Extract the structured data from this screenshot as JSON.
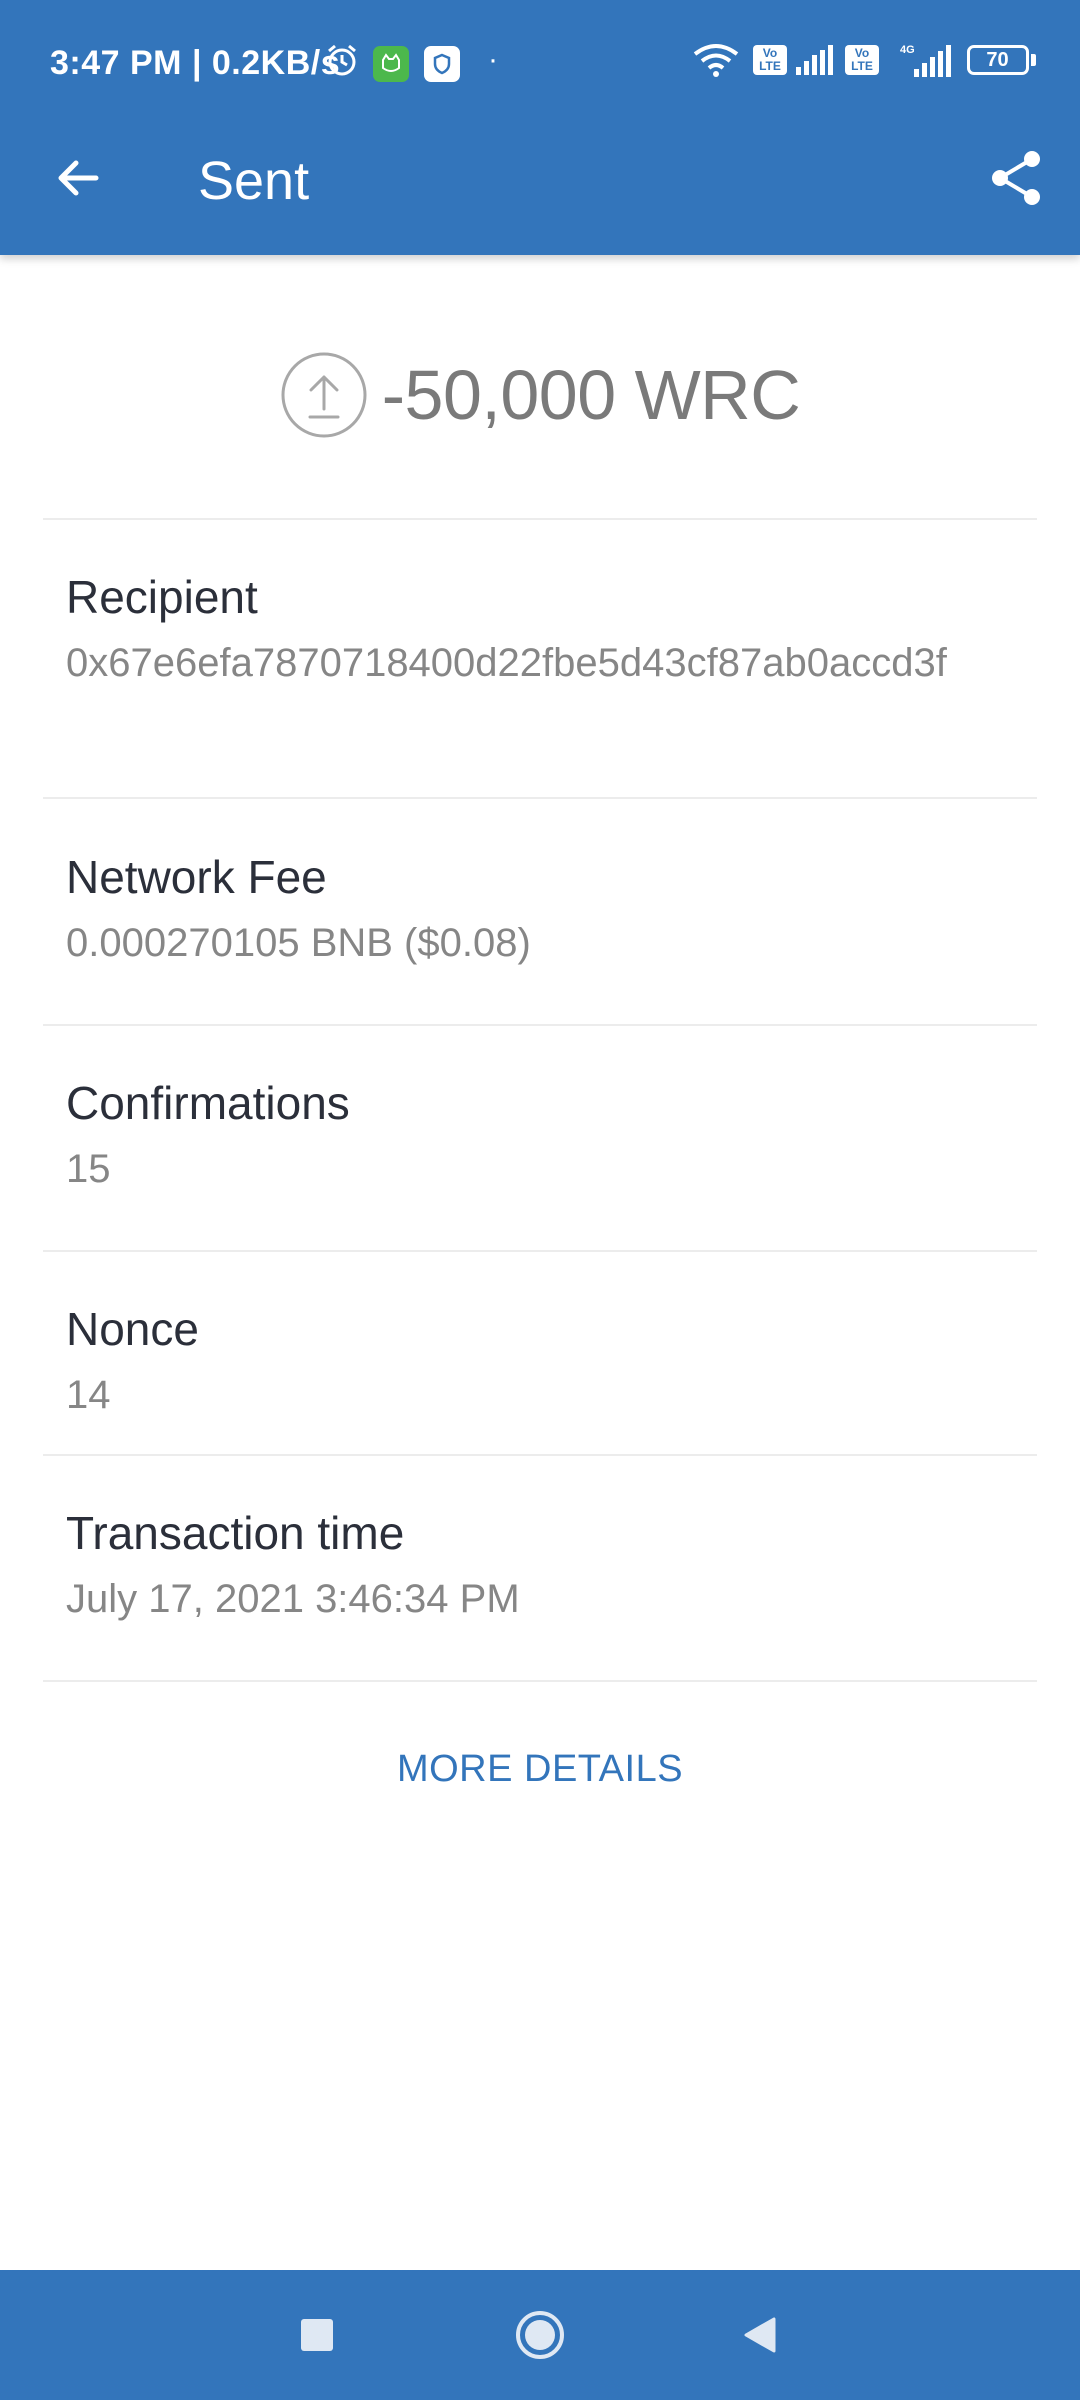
{
  "status_bar": {
    "time": "3:47 PM | 0.2KB/s",
    "volte_label": "Vo LTE",
    "network_label": "4G",
    "battery_level": "70"
  },
  "app_bar": {
    "title": "Sent"
  },
  "transaction": {
    "amount": "-50,000 WRC",
    "fields": [
      {
        "label": "Recipient",
        "value": "0x67e6efa7870718400d22fbe5d43cf87ab0accd3f"
      },
      {
        "label": "Network Fee",
        "value": "0.000270105 BNB ($0.08)"
      },
      {
        "label": "Confirmations",
        "value": "15"
      },
      {
        "label": "Nonce",
        "value": "14"
      },
      {
        "label": "Transaction time",
        "value": "July 17, 2021 3:46:34 PM"
      }
    ],
    "more_details_label": "MORE DETAILS"
  },
  "icons": {
    "back": "arrow-left-icon",
    "share": "share-icon",
    "sent": "upload-arrow-circle-icon"
  },
  "colors": {
    "primary": "#3375BB",
    "label_text": "#2b2f3a",
    "value_text": "#868686"
  }
}
